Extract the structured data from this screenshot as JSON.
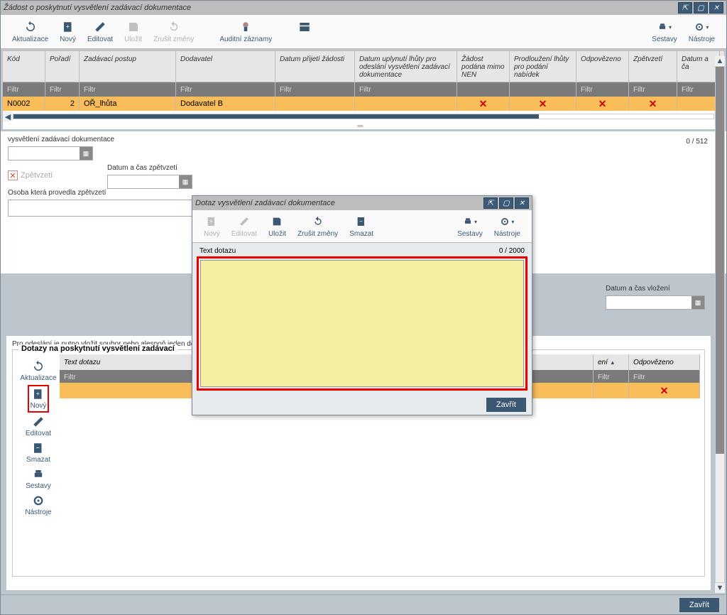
{
  "main": {
    "title": "Žádost o poskytnutí vysvětlení zadávací dokumentace",
    "toolbar": {
      "refresh": "Aktualizace",
      "new": "Nový",
      "edit": "Editovat",
      "save": "Uložit",
      "cancel": "Zrušit změny",
      "audit": "Auditní záznamy",
      "reports": "Sestavy",
      "tools": "Nástroje"
    },
    "close_btn": "Zavřít"
  },
  "table": {
    "headers": {
      "code": "Kód",
      "order": "Pořadí",
      "procedure": "Zadávací postup",
      "supplier": "Dodavatel",
      "date_received": "Datum přijetí žádosti",
      "deadline_explain": "Datum uplynutí lhůty pro odeslání vysvětlení zadávací dokumentace",
      "outside_nen": "Žádost podána mimo NEN",
      "extend_deadline": "Prodloužení lhůty pro podání nabídek",
      "answered": "Odpovězeno",
      "withdrawn": "Zpětvzetí",
      "datetime": "Datum a ča"
    },
    "filter_label": "Filtr",
    "row": {
      "code": "N0002",
      "order": "2",
      "procedure": "OŘ_lhůta",
      "supplier": "Dodavatel B"
    }
  },
  "form": {
    "label_explain": "vysvětlení zadávací dokumentace",
    "label_date_withdraw": "Datum a čas zpětvzetí",
    "label_withdrawn": "Zpětvzetí",
    "label_person": "Osoba která provedla zpětvzetí",
    "label_date_insert": "Datum a čas vložení",
    "counter": "0 / 512"
  },
  "subsection": {
    "hint": "Pro odeslání je nutno vložit soubor nebo alespoň jeden dotaz",
    "legend": "Dotazy na poskytnutí vysvětlení zadávací",
    "side": {
      "refresh": "Aktualizace",
      "new": "Nový",
      "edit": "Editovat",
      "delete": "Smazat",
      "reports": "Sestavy",
      "tools": "Nástroje"
    },
    "headers": {
      "text": "Text dotazu",
      "ins": "ení",
      "answered": "Odpovězeno"
    }
  },
  "modal": {
    "title": "Dotaz vysvětlení zadávací dokumentace",
    "toolbar": {
      "new": "Nový",
      "edit": "Editovat",
      "save": "Uložit",
      "cancel": "Zrušit změny",
      "delete": "Smazat",
      "reports": "Sestavy",
      "tools": "Nástroje"
    },
    "field_label": "Text dotazu",
    "counter": "0 / 2000",
    "close_btn": "Zavřít"
  }
}
